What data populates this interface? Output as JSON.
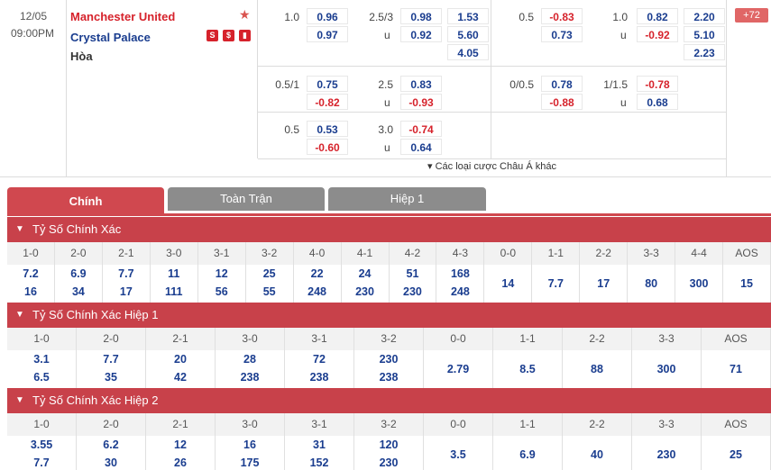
{
  "match": {
    "date": "12/05",
    "time": "09:00PM",
    "home_team": "Manchester United",
    "away_team": "Crystal Palace",
    "draw_label": "Hòa",
    "more_count": "+72",
    "more_bets_label": "▾ Các loại cược Châu Á khác",
    "ft_row1": {
      "hcp": "1.0",
      "h1": "0.96",
      "h2": "0.97",
      "ou": "2.5/3",
      "o1": "0.98",
      "o2": "0.92",
      "u": "u",
      "x1": "1.53",
      "x2": "5.60",
      "x3": "4.05"
    },
    "ht_row1": {
      "hcp": "0.5",
      "h1": "-0.83",
      "h2": "0.73",
      "ou": "1.0",
      "o1": "0.82",
      "o2": "-0.92",
      "u": "u",
      "x1": "2.20",
      "x2": "5.10",
      "x3": "2.23"
    },
    "ft_row2": {
      "hcp": "0.5/1",
      "h1": "0.75",
      "h2": "-0.82",
      "ou": "2.5",
      "o1": "0.83",
      "o2": "-0.93",
      "u": "u"
    },
    "ht_row2": {
      "hcp": "0/0.5",
      "h1": "0.78",
      "h2": "-0.88",
      "ou": "1/1.5",
      "o1": "-0.78",
      "o2": "0.68",
      "u": "u"
    },
    "ft_row3": {
      "hcp": "0.5",
      "h1": "0.53",
      "h2": "-0.60",
      "ou": "3.0",
      "o1": "-0.74",
      "o2": "0.64",
      "u": "u"
    }
  },
  "tabs": [
    "Chính",
    "Toàn Trận",
    "Hiệp 1"
  ],
  "sections": [
    {
      "title": "Tỷ Số Chính Xác",
      "headers": [
        "1-0",
        "2-0",
        "2-1",
        "3-0",
        "3-1",
        "3-2",
        "4-0",
        "4-1",
        "4-2",
        "4-3",
        "0-0",
        "1-1",
        "2-2",
        "3-3",
        "4-4",
        "AOS"
      ],
      "cells": [
        [
          "7.2",
          "16"
        ],
        [
          "6.9",
          "34"
        ],
        [
          "7.7",
          "17"
        ],
        [
          "11",
          "111"
        ],
        [
          "12",
          "56"
        ],
        [
          "25",
          "55"
        ],
        [
          "22",
          "248"
        ],
        [
          "24",
          "230"
        ],
        [
          "51",
          "230"
        ],
        [
          "168",
          "248"
        ],
        [
          "14"
        ],
        [
          "7.7"
        ],
        [
          "17"
        ],
        [
          "80"
        ],
        [
          "300"
        ],
        [
          "15"
        ]
      ]
    },
    {
      "title": "Tỷ Số Chính Xác Hiệp 1",
      "headers": [
        "1-0",
        "2-0",
        "2-1",
        "3-0",
        "3-1",
        "3-2",
        "0-0",
        "1-1",
        "2-2",
        "3-3",
        "AOS"
      ],
      "cells": [
        [
          "3.1",
          "6.5"
        ],
        [
          "7.7",
          "35"
        ],
        [
          "20",
          "42"
        ],
        [
          "28",
          "238"
        ],
        [
          "72",
          "238"
        ],
        [
          "230",
          "238"
        ],
        [
          "2.79"
        ],
        [
          "8.5"
        ],
        [
          "88"
        ],
        [
          "300"
        ],
        [
          "71"
        ]
      ]
    },
    {
      "title": "Tỷ Số Chính Xác Hiệp 2",
      "headers": [
        "1-0",
        "2-0",
        "2-1",
        "3-0",
        "3-1",
        "3-2",
        "0-0",
        "1-1",
        "2-2",
        "3-3",
        "AOS"
      ],
      "cells": [
        [
          "3.55",
          "7.7"
        ],
        [
          "6.2",
          "30"
        ],
        [
          "12",
          "26"
        ],
        [
          "16",
          "175"
        ],
        [
          "31",
          "152"
        ],
        [
          "120",
          "230"
        ],
        [
          "3.5"
        ],
        [
          "6.9"
        ],
        [
          "40"
        ],
        [
          "230"
        ],
        [
          "25"
        ]
      ]
    }
  ]
}
